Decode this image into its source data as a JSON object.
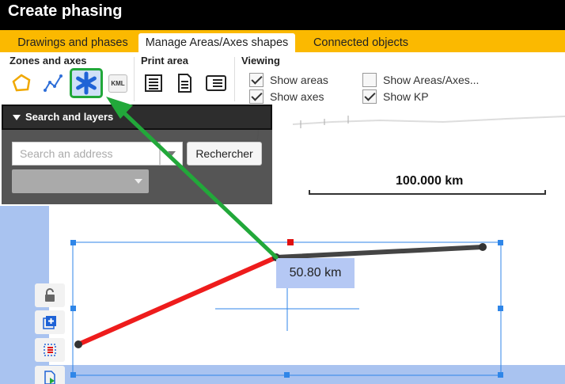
{
  "window": {
    "title": "Create phasing"
  },
  "tabs": [
    {
      "label": "Drawings and phases",
      "active": false
    },
    {
      "label": "Manage Areas/Axes shapes",
      "active": true
    },
    {
      "label": "Connected objects",
      "active": false
    }
  ],
  "ribbon": {
    "zones_axes": {
      "label": "Zones and axes",
      "buttons": [
        {
          "icon": "polygon-icon"
        },
        {
          "icon": "polyline-icon"
        },
        {
          "icon": "asterisk-icon",
          "selected": true
        },
        {
          "icon": "kml-icon",
          "text": "KML"
        }
      ]
    },
    "print_area": {
      "label": "Print area",
      "buttons": [
        {
          "icon": "print-list-icon"
        },
        {
          "icon": "print-document-icon"
        },
        {
          "icon": "print-landscape-icon"
        }
      ]
    },
    "viewing": {
      "label": "Viewing",
      "options": [
        {
          "label": "Show areas",
          "checked": true
        },
        {
          "label": "Show axes",
          "checked": true
        },
        {
          "label": "Show Areas/Axes...",
          "checked": false
        },
        {
          "label": "Show KP",
          "checked": true
        }
      ]
    }
  },
  "search_panel": {
    "title": "Search and layers",
    "input_placeholder": "Search an address",
    "input_value": "",
    "search_button": "Rechercher",
    "layer_select_value": ""
  },
  "map": {
    "scale_label": "100.000 km",
    "distance_label": "50.80 km",
    "colors": {
      "segment_red": "#ee1c1c",
      "segment_dark": "#444444",
      "selection": "#2f86e8",
      "annotation_arrow": "#22a83a"
    }
  },
  "map_tools": [
    {
      "icon": "lock-icon"
    },
    {
      "icon": "add-layer-icon"
    },
    {
      "icon": "grid-select-icon"
    },
    {
      "icon": "document-export-icon"
    }
  ]
}
